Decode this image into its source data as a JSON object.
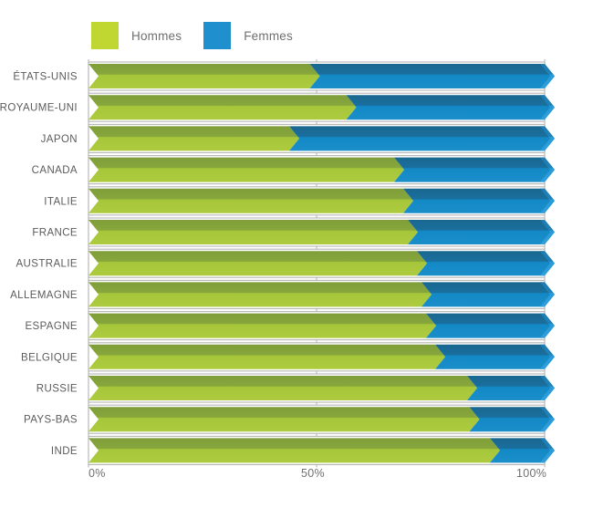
{
  "legend": {
    "items": [
      {
        "label": "Hommes",
        "color": "#bfd730",
        "icon": "legend-swatch-hommes"
      },
      {
        "label": "Femmes",
        "color": "#1f8fcd",
        "icon": "legend-swatch-femmes"
      }
    ]
  },
  "axis": {
    "ticks": [
      {
        "label": "0%",
        "value": 0
      },
      {
        "label": "50%",
        "value": 50
      },
      {
        "label": "100%",
        "value": 100
      }
    ]
  },
  "colors": {
    "hommes_dark": "#83a23c",
    "hommes_light": "#a6c63a",
    "femmes_dark": "#1b6a9c",
    "femmes_light": "#1289c6",
    "gridline": "#b5b5b5",
    "track": "#ffffff",
    "text": "#5b5b5b"
  },
  "chart_data": {
    "type": "bar",
    "orientation": "horizontal",
    "stacked": true,
    "normalized": true,
    "title": "",
    "subtitle": "",
    "xlabel": "",
    "ylabel": "",
    "xlim": [
      0,
      100
    ],
    "grid": true,
    "legend_position": "top-left",
    "categories": [
      "ÉTATS-UNIS",
      "ROYAUME-UNI",
      "JAPON",
      "CANADA",
      "ITALIE",
      "FRANCE",
      "AUSTRALIE",
      "ALLEMAGNE",
      "ESPAGNE",
      "BELGIQUE",
      "RUSSIE",
      "PAYS-BAS",
      "INDE"
    ],
    "series": [
      {
        "name": "Hommes",
        "color": "#a6c63a",
        "values": [
          48.5,
          56.5,
          44,
          67,
          69,
          70,
          72,
          73,
          74,
          76,
          83,
          83.5,
          88
        ]
      },
      {
        "name": "Femmes",
        "color": "#1289c6",
        "values": [
          51.5,
          43.5,
          56,
          33,
          31,
          30,
          28,
          27,
          26,
          24,
          17,
          16.5,
          12
        ]
      }
    ],
    "tick_values": [
      0,
      50,
      100
    ],
    "tick_labels": [
      "0%",
      "50%",
      "100%"
    ]
  }
}
